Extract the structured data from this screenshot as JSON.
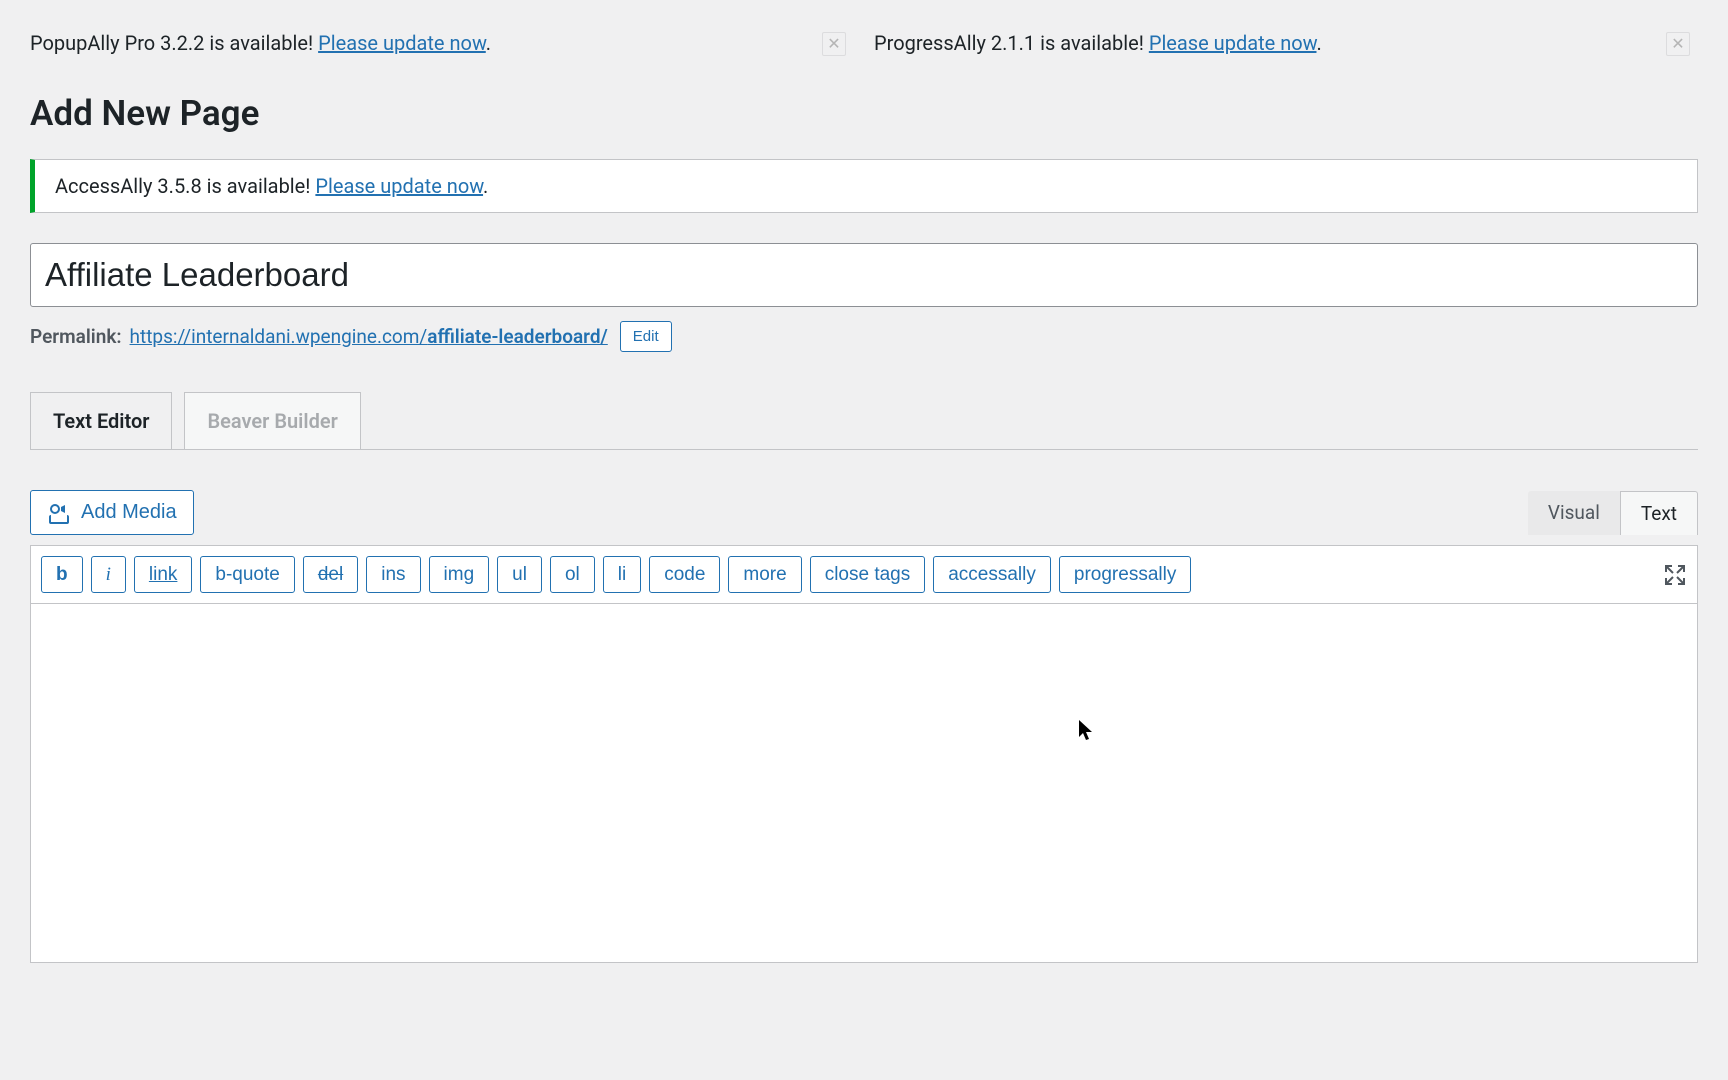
{
  "notices": {
    "top": [
      {
        "text_prefix": "PopupAlly Pro 3.2.2 is available! ",
        "link_text": "Please update now"
      },
      {
        "text_prefix": "ProgressAlly 2.1.1 is available! ",
        "link_text": "Please update now"
      }
    ],
    "inline": {
      "text_prefix": "AccessAlly 3.5.8 is available! ",
      "link_text": "Please update now"
    }
  },
  "page": {
    "heading": "Add New Page",
    "title_value": "Affiliate Leaderboard",
    "permalink_label": "Permalink:",
    "permalink_base": "https://internaldani.wpengine.com/",
    "permalink_slug": "affiliate-leaderboard/",
    "edit_label": "Edit"
  },
  "editor_tabs": {
    "text_editor": "Text Editor",
    "beaver_builder": "Beaver Builder"
  },
  "toolbar": {
    "add_media": "Add Media",
    "visual": "Visual",
    "text": "Text"
  },
  "quicktags": [
    {
      "label": "b",
      "cls": "b"
    },
    {
      "label": "i",
      "cls": "i"
    },
    {
      "label": "link",
      "cls": "link"
    },
    {
      "label": "b-quote",
      "cls": ""
    },
    {
      "label": "del",
      "cls": "del"
    },
    {
      "label": "ins",
      "cls": ""
    },
    {
      "label": "img",
      "cls": ""
    },
    {
      "label": "ul",
      "cls": ""
    },
    {
      "label": "ol",
      "cls": ""
    },
    {
      "label": "li",
      "cls": ""
    },
    {
      "label": "code",
      "cls": ""
    },
    {
      "label": "more",
      "cls": ""
    },
    {
      "label": "close tags",
      "cls": ""
    },
    {
      "label": "accessally",
      "cls": ""
    },
    {
      "label": "progressally",
      "cls": ""
    }
  ]
}
